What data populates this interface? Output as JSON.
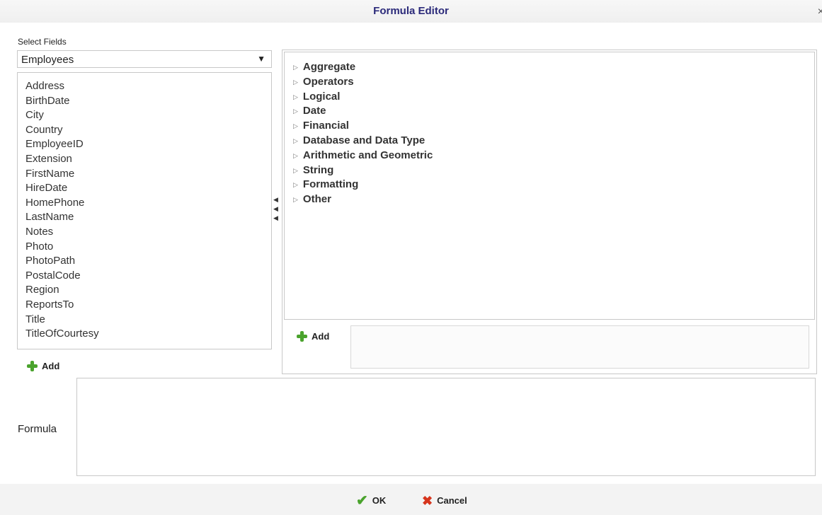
{
  "dialog": {
    "title": "Formula Editor",
    "close_glyph": "×"
  },
  "fields_panel": {
    "label": "Select Fields",
    "table_selected": "Employees",
    "dropdown_arrow": "▼",
    "items": [
      "Address",
      "BirthDate",
      "City",
      "Country",
      "EmployeeID",
      "Extension",
      "FirstName",
      "HireDate",
      "HomePhone",
      "LastName",
      "Notes",
      "Photo",
      "PhotoPath",
      "PostalCode",
      "Region",
      "ReportsTo",
      "Title",
      "TitleOfCourtesy"
    ],
    "add_label": "Add"
  },
  "functions_panel": {
    "categories": [
      "Aggregate",
      "Operators",
      "Logical",
      "Date",
      "Financial",
      "Database and Data Type",
      "Arithmetic and Geometric",
      "String",
      "Formatting",
      "Other"
    ],
    "expand_glyph": "▷",
    "add_label": "Add"
  },
  "splitter": {
    "glyphs": [
      "◀",
      "◀",
      "◀"
    ]
  },
  "formula": {
    "label": "Formula",
    "value": ""
  },
  "footer": {
    "ok_label": "OK",
    "cancel_label": "Cancel",
    "ok_glyph": "✔",
    "cancel_glyph": "✖"
  },
  "icons": {
    "add": "plus-icon",
    "ok": "check-icon",
    "cancel": "x-icon",
    "close": "close-icon"
  },
  "colors": {
    "title": "#2b2a7a",
    "add_green": "#4aa32d",
    "cancel_red": "#d6341c"
  }
}
